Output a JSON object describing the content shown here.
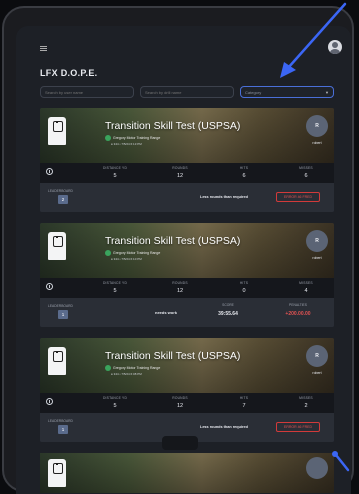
{
  "page": {
    "title": "LFX D.O.P.E."
  },
  "filters": {
    "user_placeholder": "Search by user name",
    "drill_placeholder": "Search by drill name",
    "category_placeholder": "Category"
  },
  "cards": [
    {
      "title": "Transition Skill Test (USPSA)",
      "owner": "Gregory Motor Training Range",
      "meta": "● 344 • 7/5/24 6:13 PM",
      "avatar_initial": "R",
      "user": "robert",
      "stats": [
        {
          "label": "DISTANCE YD",
          "value": "5"
        },
        {
          "label": "ROUNDS",
          "value": "12"
        },
        {
          "label": "HITS",
          "value": "6"
        },
        {
          "label": "MISSES",
          "value": "6"
        }
      ],
      "footer": {
        "leaderboard_label": "LEADERBOARD",
        "leaderboard_rank": "2",
        "status": "Less rounds than required",
        "error": "ERROR 46 FRED"
      }
    },
    {
      "title": "Transition Skill Test (USPSA)",
      "owner": "Gregory Motor Training Range",
      "meta": "● 344 • 7/5/24 6:10 PM",
      "avatar_initial": "R",
      "user": "robert",
      "stats": [
        {
          "label": "DISTANCE YD",
          "value": "5"
        },
        {
          "label": "ROUNDS",
          "value": "12"
        },
        {
          "label": "HITS",
          "value": "0"
        },
        {
          "label": "MISSES",
          "value": "4"
        }
      ],
      "footer": {
        "leaderboard_label": "LEADERBOARD",
        "leaderboard_rank": "1",
        "status": "needs work",
        "score_label": "SCORE",
        "score": "39:55.64",
        "penalties_label": "PENALTIES",
        "penalties": "+200.00.00"
      }
    },
    {
      "title": "Transition Skill Test (USPSA)",
      "owner": "Gregory Motor Training Range",
      "meta": "● 344 • 7/5/24 6:08 PM",
      "avatar_initial": "R",
      "user": "robert",
      "stats": [
        {
          "label": "DISTANCE YD",
          "value": "5"
        },
        {
          "label": "ROUNDS",
          "value": "12"
        },
        {
          "label": "HITS",
          "value": "7"
        },
        {
          "label": "MISSES",
          "value": "2"
        }
      ],
      "footer": {
        "leaderboard_label": "LEADERBOARD",
        "leaderboard_rank": "1",
        "status": "Less rounds than required",
        "error": "ERROR 46 FRED"
      }
    }
  ],
  "colors": {
    "accent": "#4a6fd8",
    "error": "#d23a3a",
    "penalty": "#e05252",
    "arrow": "#3b66f5"
  }
}
